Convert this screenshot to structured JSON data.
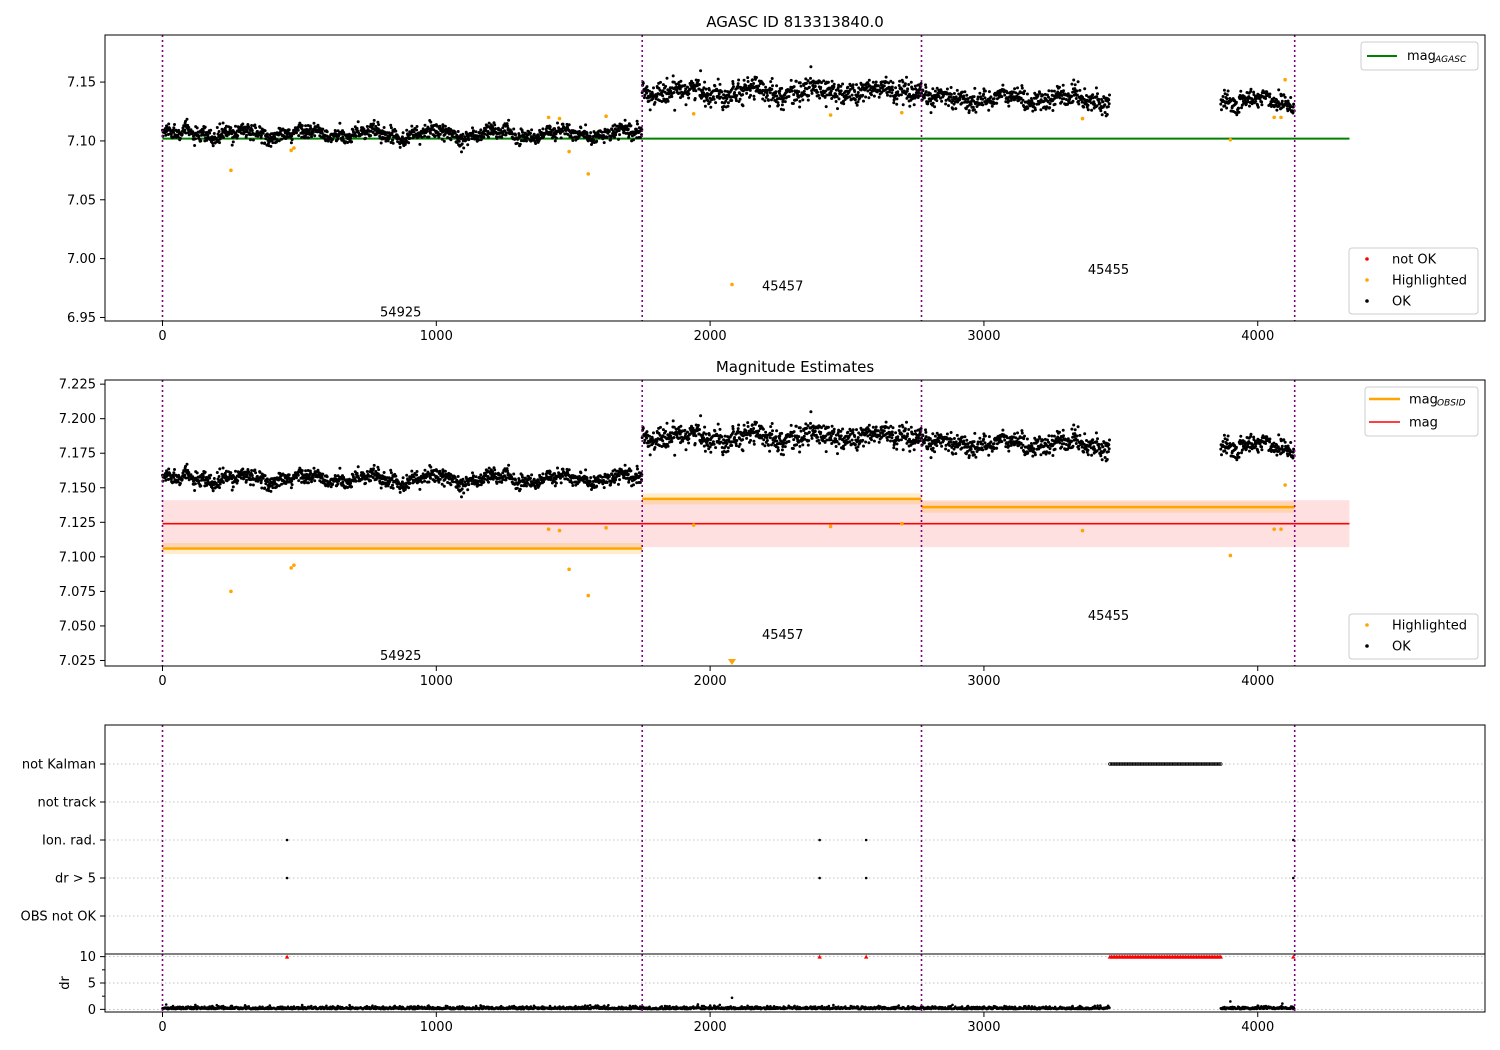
{
  "chart_data": [
    {
      "type": "scatter",
      "title": "AGASC ID 813313840.0",
      "xlim": [
        -210,
        4830
      ],
      "ylim": [
        6.947,
        7.19
      ],
      "yticks": [
        6.95,
        7.0,
        7.05,
        7.1,
        7.15
      ],
      "ytick_labels": [
        "6.95",
        "7.00",
        "7.05",
        "7.10",
        "7.15"
      ],
      "xticks": [
        0,
        1000,
        2000,
        3000,
        4000
      ],
      "xtick_labels": [
        "0",
        "1000",
        "2000",
        "3000",
        "4000"
      ],
      "obs_boundaries": [
        0,
        1752,
        2772,
        4135
      ],
      "obsid_labels": [
        {
          "text": "54925",
          "x": 870,
          "y": 6.955
        },
        {
          "text": "45457",
          "x": 2265,
          "y": 6.977
        },
        {
          "text": "45455",
          "x": 3455,
          "y": 6.991
        }
      ],
      "mag_agasc": 7.102,
      "mag_agasc_range": [
        0,
        4335
      ],
      "segments": [
        {
          "x_start": 0,
          "x_end": 1752,
          "mean": 7.106,
          "noise": 0.004
        },
        {
          "x_start": 1752,
          "x_end": 2772,
          "mean": 7.142,
          "noise": 0.006
        },
        {
          "x_start": 2772,
          "x_end": 3460,
          "mean": 7.136,
          "noise": 0.005
        },
        {
          "x_start": 3865,
          "x_end": 4135,
          "mean": 7.134,
          "noise": 0.005
        }
      ],
      "highlighted_points": [
        {
          "x": 250,
          "y": 7.075
        },
        {
          "x": 470,
          "y": 7.092
        },
        {
          "x": 480,
          "y": 7.094
        },
        {
          "x": 1485,
          "y": 7.091
        },
        {
          "x": 1555,
          "y": 7.072
        },
        {
          "x": 1410,
          "y": 7.12
        },
        {
          "x": 1450,
          "y": 7.119
        },
        {
          "x": 1620,
          "y": 7.121
        },
        {
          "x": 2080,
          "y": 6.978
        },
        {
          "x": 1940,
          "y": 7.123
        },
        {
          "x": 2440,
          "y": 7.122
        },
        {
          "x": 2700,
          "y": 7.124
        },
        {
          "x": 3360,
          "y": 7.119
        },
        {
          "x": 3900,
          "y": 7.101
        },
        {
          "x": 4060,
          "y": 7.12
        },
        {
          "x": 4085,
          "y": 7.12
        },
        {
          "x": 4100,
          "y": 7.152
        }
      ],
      "legend_lines": [
        {
          "label": "mag",
          "sub": "AGASC",
          "color": "#008000"
        }
      ],
      "legend_points": [
        {
          "label": "not OK",
          "color": "#ff0000"
        },
        {
          "label": "Highlighted",
          "color": "#ffa500"
        },
        {
          "label": "OK",
          "color": "#000000"
        }
      ],
      "legend_placement": [
        "top-right",
        "bottom-right"
      ]
    },
    {
      "type": "scatter",
      "title": "Magnitude Estimates",
      "xlim": [
        -210,
        4830
      ],
      "ylim": [
        7.021,
        7.228
      ],
      "yticks": [
        7.025,
        7.05,
        7.075,
        7.1,
        7.125,
        7.15,
        7.175,
        7.2,
        7.225
      ],
      "ytick_labels": [
        "7.025",
        "7.050",
        "7.075",
        "7.100",
        "7.125",
        "7.150",
        "7.175",
        "7.200",
        "7.225"
      ],
      "xticks": [
        0,
        1000,
        2000,
        3000,
        4000
      ],
      "xtick_labels": [
        "0",
        "1000",
        "2000",
        "3000",
        "4000"
      ],
      "obs_boundaries": [
        0,
        1752,
        2772,
        4135
      ],
      "obsid_labels": [
        {
          "text": "54925",
          "x": 870,
          "y": 7.029
        },
        {
          "text": "45457",
          "x": 2265,
          "y": 7.044
        },
        {
          "text": "45455",
          "x": 3455,
          "y": 7.058
        }
      ],
      "mag": 7.124,
      "mag_band": [
        7.107,
        7.141
      ],
      "mag_range": [
        0,
        4335
      ],
      "mag_obsid": [
        {
          "x_start": 0,
          "x_end": 1752,
          "value": 7.106
        },
        {
          "x_start": 1752,
          "x_end": 2772,
          "value": 7.142
        },
        {
          "x_start": 2772,
          "x_end": 4135,
          "value": 7.136
        }
      ],
      "mag_obsid_band_half_width": 0.004,
      "highlighted_points": [
        {
          "x": 250,
          "y": 7.075
        },
        {
          "x": 470,
          "y": 7.092
        },
        {
          "x": 480,
          "y": 7.094
        },
        {
          "x": 1485,
          "y": 7.091
        },
        {
          "x": 1555,
          "y": 7.072
        },
        {
          "x": 1410,
          "y": 7.12
        },
        {
          "x": 1450,
          "y": 7.119
        },
        {
          "x": 1620,
          "y": 7.121
        },
        {
          "x": 1940,
          "y": 7.123
        },
        {
          "x": 2440,
          "y": 7.122
        },
        {
          "x": 2700,
          "y": 7.124
        },
        {
          "x": 3360,
          "y": 7.119
        },
        {
          "x": 3900,
          "y": 7.101
        },
        {
          "x": 4060,
          "y": 7.12
        },
        {
          "x": 4085,
          "y": 7.12
        },
        {
          "x": 4100,
          "y": 7.152
        }
      ],
      "out_of_range_marker": {
        "x": 2080
      },
      "legend_lines": [
        {
          "label": "mag",
          "sub": "OBSID",
          "color": "#ffa500"
        },
        {
          "label": "mag",
          "sub": "",
          "color": "#ff0000"
        }
      ],
      "legend_points": [
        {
          "label": "Highlighted",
          "color": "#ffa500"
        },
        {
          "label": "OK",
          "color": "#000000"
        }
      ],
      "legend_placement": [
        "top-right",
        "bottom-right"
      ]
    },
    {
      "type": "scatter",
      "title": "",
      "xlim": [
        -210,
        4830
      ],
      "flag_labels": [
        "not Kalman",
        "not track",
        "Ion. rad.",
        "dr > 5",
        "OBS not OK"
      ],
      "flag_points": {
        "not Kalman": [
          {
            "x_start": 3460,
            "x_end": 3865,
            "count": 70
          }
        ],
        "Ion. rad.": [
          {
            "x": 455
          },
          {
            "x": 2400
          },
          {
            "x": 2570
          },
          {
            "x": 4130
          }
        ],
        "dr > 5": [
          {
            "x": 455
          },
          {
            "x": 2400
          },
          {
            "x": 2570
          },
          {
            "x": 4130
          }
        ]
      },
      "obs_boundaries": [
        0,
        1752,
        2772,
        4135
      ]
    },
    {
      "type": "scatter",
      "title": "",
      "ylabel": "dr",
      "xlim": [
        -210,
        4830
      ],
      "ylim": [
        -0.5,
        10.5
      ],
      "yticks": [
        0,
        5,
        10
      ],
      "ytick_labels": [
        "0",
        "5",
        "10"
      ],
      "xticks": [
        0,
        1000,
        2000,
        3000,
        4000
      ],
      "xtick_labels": [
        "0",
        "1000",
        "2000",
        "3000",
        "4000"
      ],
      "dr_segments": [
        {
          "x_start": 0,
          "x_end": 1752
        },
        {
          "x_start": 1752,
          "x_end": 2772
        },
        {
          "x_start": 2772,
          "x_end": 3460
        },
        {
          "x_start": 3865,
          "x_end": 4135
        }
      ],
      "dr_outliers": [
        {
          "x": 2080,
          "y": 2.2
        },
        {
          "x": 3900,
          "y": 1.5
        },
        {
          "x": 4090,
          "y": 1.1
        }
      ],
      "dr_clipped": [
        {
          "x": 455,
          "y": 10
        },
        {
          "x": 2400,
          "y": 10
        },
        {
          "x": 2570,
          "y": 10
        },
        {
          "x": 4130,
          "y": 10
        },
        {
          "x_start": 3460,
          "x_end": 3865,
          "y": 10,
          "count": 70
        }
      ],
      "obs_boundaries": [
        0,
        1752,
        2772,
        4135
      ]
    }
  ]
}
